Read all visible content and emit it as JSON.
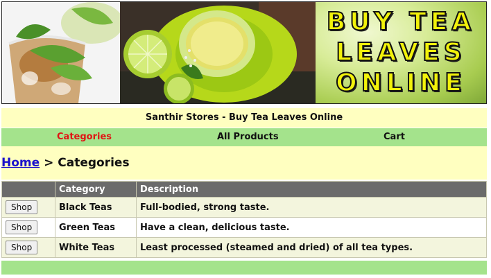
{
  "banner": {
    "title_lines": [
      "BUY TEA",
      "LEAVES",
      "ONLINE"
    ]
  },
  "store": {
    "name": "Santhir Stores - Buy Tea Leaves Online"
  },
  "nav": {
    "items": [
      {
        "label": "Categories",
        "active": true
      },
      {
        "label": "All Products",
        "active": false
      },
      {
        "label": "Cart",
        "active": false
      }
    ]
  },
  "breadcrumb": {
    "home": "Home",
    "separator": ">",
    "current": "Categories"
  },
  "table": {
    "headers": [
      "",
      "Category",
      "Description"
    ],
    "rows": [
      {
        "button": "Shop",
        "category": "Black Teas",
        "description": "Full-bodied, strong taste."
      },
      {
        "button": "Shop",
        "category": "Green Teas",
        "description": "Have a clean, delicious taste."
      },
      {
        "button": "Shop",
        "category": "White Teas",
        "description": "Least processed (steamed and dried) of all tea types."
      }
    ]
  },
  "colors": {
    "nav_bg": "#a4e38c",
    "bar_bg": "#ffffc0",
    "header_bg": "#6b6b6b",
    "active_link": "#e01414",
    "link": "#1a10cc",
    "title_text": "#f2f20a"
  }
}
